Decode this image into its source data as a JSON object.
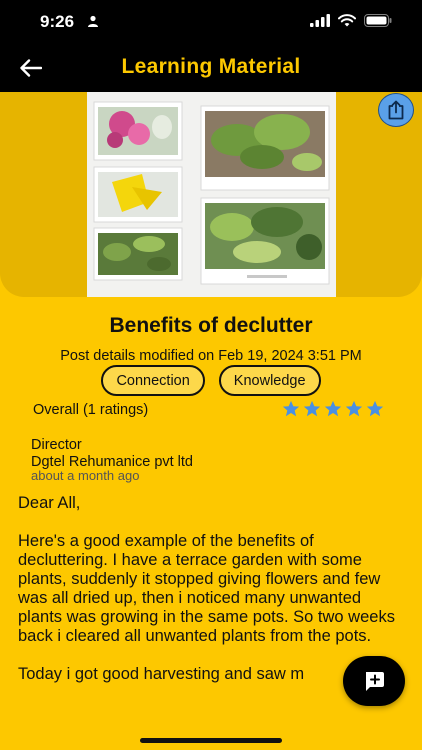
{
  "status": {
    "time": "9:26"
  },
  "app_bar": {
    "title": "Learning Material"
  },
  "post": {
    "title": "Benefits of declutter",
    "meta": "Post details modified on Feb 19, 2024 3:51 PM",
    "tags": [
      "Connection",
      "Knowledge"
    ],
    "rating_label": "Overall (1 ratings)",
    "stars": 5,
    "author_role": "Director",
    "author_company": "Dgtel Rehumanice pvt ltd",
    "author_time": "about a month ago",
    "body": [
      "Dear All,",
      "Here's a good example of the benefits of decluttering. I have a terrace garden with some plants, suddenly it stopped giving flowers and few was all dried up, then i noticed many unwanted plants was growing in the same pots. So two weeks back i cleared all unwanted plants from the pots.",
      "Today i got good harvesting and saw m"
    ]
  },
  "colors": {
    "accent": "#fdc800",
    "header": "#000000",
    "star": "#4a90e2",
    "share": "#5aa0e8"
  }
}
